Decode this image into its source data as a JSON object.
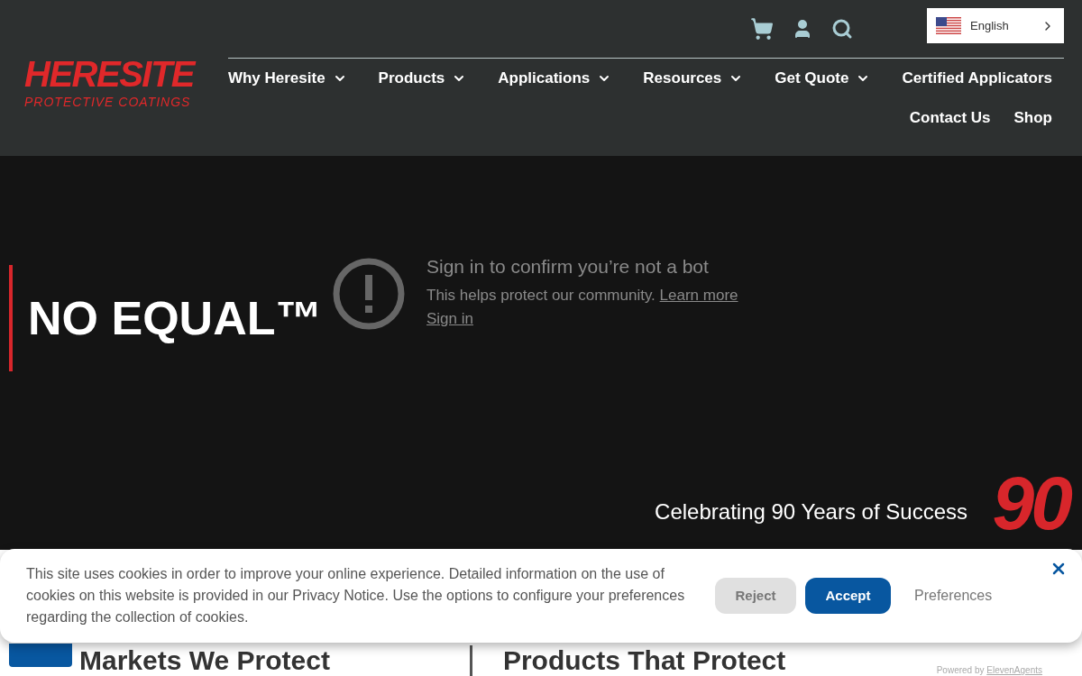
{
  "header": {
    "logo": {
      "name": "HERESITE",
      "tagline": "PROTECTIVE COATINGS"
    },
    "language": {
      "label": "English"
    },
    "nav": [
      {
        "label": "Why Heresite",
        "dropdown": true
      },
      {
        "label": "Products",
        "dropdown": true
      },
      {
        "label": "Applications",
        "dropdown": true
      },
      {
        "label": "Resources",
        "dropdown": true
      },
      {
        "label": "Get Quote",
        "dropdown": true
      },
      {
        "label": "Certified Applicators",
        "dropdown": false
      },
      {
        "label": "Contact Us",
        "dropdown": false
      },
      {
        "label": "Shop",
        "dropdown": false
      }
    ]
  },
  "hero": {
    "title": "NO EQUAL™",
    "video_notice": {
      "title": "Sign in to confirm you’re not a bot",
      "text": "This helps protect our community.",
      "learn_more": "Learn more",
      "sign_in": "Sign in"
    },
    "anniversary": {
      "text": "Celebrating 90 Years of Success",
      "badge": "90"
    }
  },
  "sections": [
    {
      "title": "Markets We Protect"
    },
    {
      "title": "Products That Protect"
    }
  ],
  "cookie_banner": {
    "text": "This site uses cookies in order to improve your online experience. Detailed information on the use of cookies on this website is provided in our Privacy Notice. Use the options to configure your preferences regarding the collection of cookies.",
    "buttons": [
      {
        "label": "Reject",
        "kind": "secondary"
      },
      {
        "label": "Accept",
        "kind": "primary"
      },
      {
        "label": "Preferences",
        "kind": "link"
      }
    ]
  },
  "powered_by": {
    "text": "Powered by",
    "link": "ElevenAgents"
  }
}
